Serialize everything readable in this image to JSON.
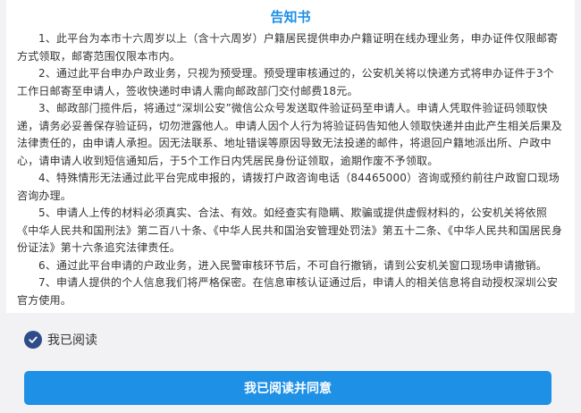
{
  "notice": {
    "title": "告知书",
    "paragraphs": [
      "1、此平台为本市十六周岁以上（含十六周岁）户籍居民提供申办户籍证明在线办理业务，申办证件仅限邮寄方式领取，邮寄范围仅限本市内。",
      "2、通过此平台申办户政业务，只视为预受理。预受理审核通过的，公安机关将以快递方式将申办证件于3个工作日邮寄至申请人，签收快递时申请人需向邮政部门交付邮费18元。",
      "3、邮政部门揽件后，将通过“深圳公安”微信公众号发送取件验证码至申请人。申请人凭取件验证码领取快递，请务必妥善保存验证码，切勿泄露他人。申请人因个人行为将验证码告知他人领取快递并由此产生相关后果及法律责任的，由申请人承担。因无法联系、地址错误等原因导致无法投递的邮件，将退回户籍地派出所、户政中心，请申请人收到短信通知后，于5个工作日内凭居民身份证领取，逾期作废不予领取。",
      "4、特殊情形无法通过此平台完成申报的，请拨打户政咨询电话（84465000）咨询或预约前往户政窗口现场咨询办理。",
      "5、申请人上传的材料必须真实、合法、有效。如经查实有隐瞒、欺骗或提供虚假材料的，公安机关将依照《中华人民共和国刑法》第二百八十条、《中华人民共和国治安管理处罚法》第五十二条、《中华人民共和国居民身份证法》第十六条追究法律责任。",
      "6、通过此平台申请的户政业务，进入民警审核环节后，不可自行撤销，请到公安机关窗口现场申请撤销。",
      "7、申请人提供的个人信息我们将严格保密。在信息审核认证通过后，申请人的相关信息将自动授权深圳公安官方使用。"
    ]
  },
  "confirm": {
    "label": "我已阅读",
    "checked": true,
    "check_color": "#2e4b8a"
  },
  "agree_button": {
    "label": "我已阅读并同意",
    "color": "#1e90e6"
  },
  "colors": {
    "title": "#1d8fe8",
    "text": "#333333"
  }
}
